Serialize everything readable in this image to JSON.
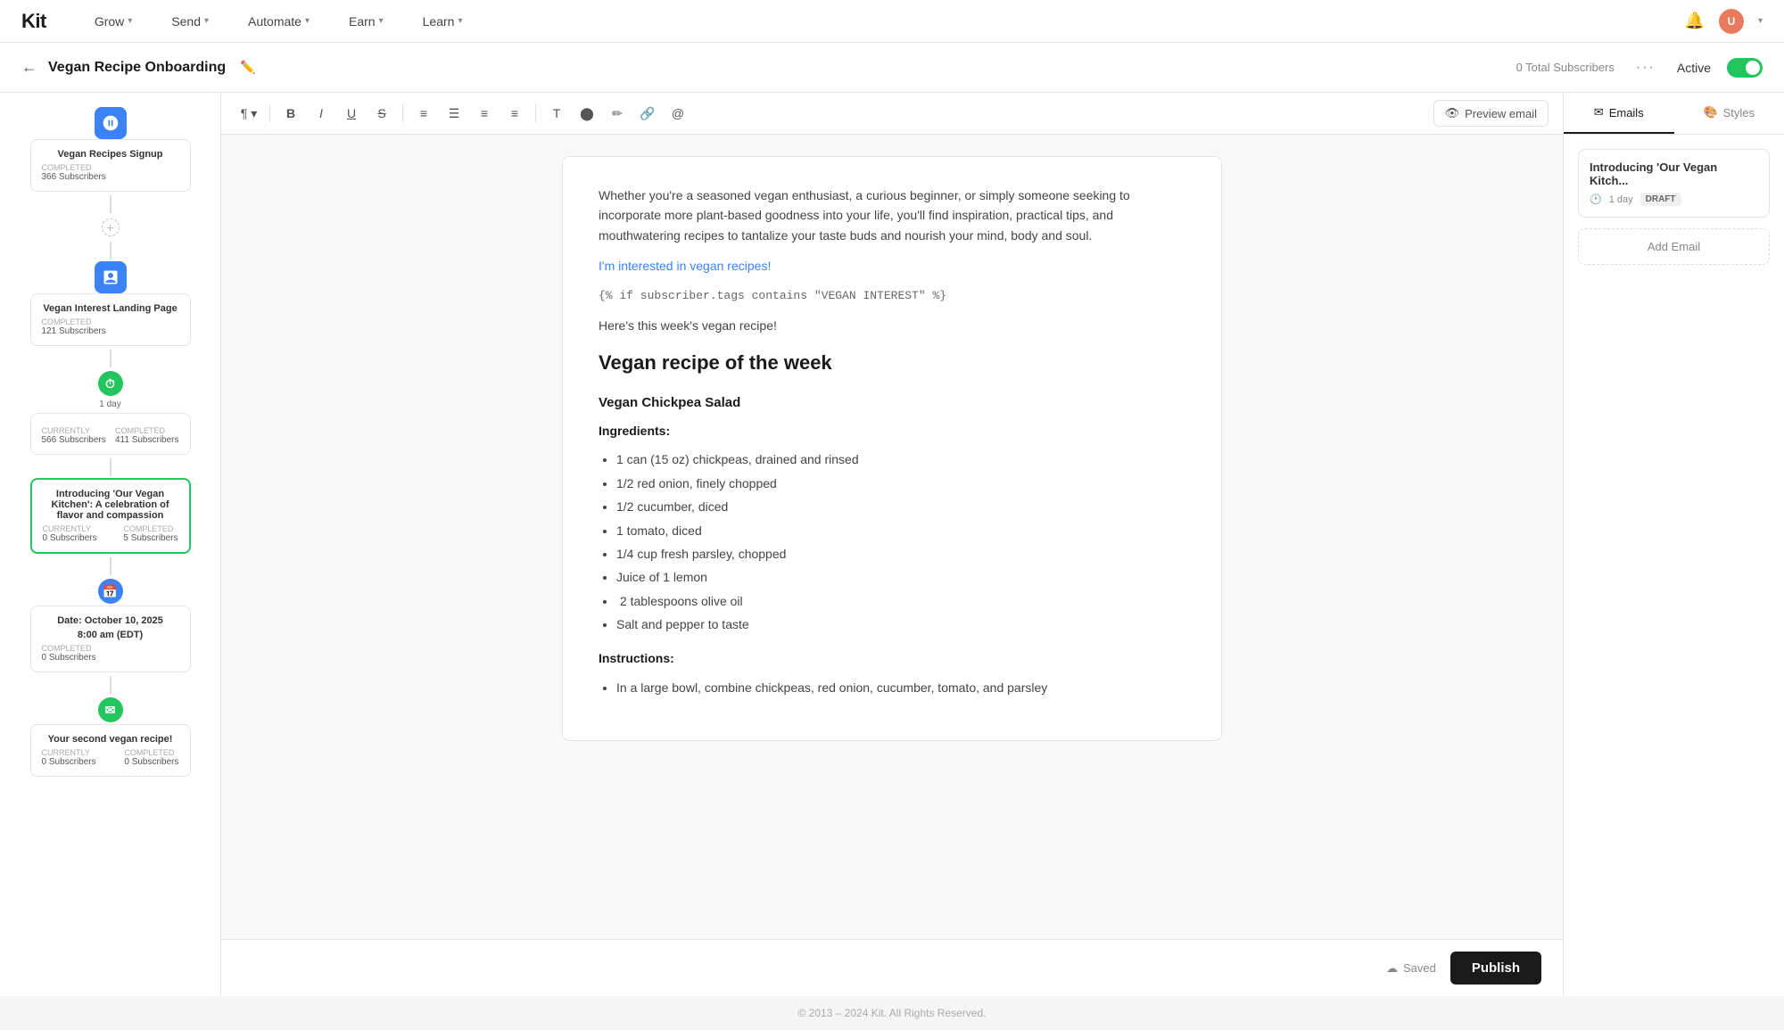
{
  "logo": "Kit",
  "nav": {
    "items": [
      {
        "label": "Grow",
        "has_chevron": true
      },
      {
        "label": "Send",
        "has_chevron": true
      },
      {
        "label": "Automate",
        "has_chevron": true
      },
      {
        "label": "Earn",
        "has_chevron": true
      },
      {
        "label": "Learn",
        "has_chevron": true
      }
    ]
  },
  "sub_header": {
    "title": "Vegan Recipe Onboarding",
    "total_subscribers": "0 Total Subscribers",
    "active_label": "Active"
  },
  "toolbar": {
    "preview_label": "Preview email"
  },
  "email": {
    "intro_text": "Whether you're a seasoned vegan enthusiast, a curious beginner, or simply someone seeking to incorporate more plant-based goodness into your life, you'll find inspiration, practical tips, and mouthwatering recipes to tantalize your taste buds and nourish your mind, body and soul.",
    "link_text": "I'm interested in vegan recipes!",
    "conditional_tag": "{% if subscriber.tags contains \"VEGAN INTEREST\" %}",
    "body_text": "Here's this week's vegan recipe!",
    "recipe_heading": "Vegan recipe of the week",
    "recipe_title": "Vegan Chickpea Salad",
    "ingredients_label": "Ingredients:",
    "ingredients": [
      "1 can (15 oz) chickpeas, drained and rinsed",
      "1/2 red onion, finely chopped",
      "1/2 cucumber, diced",
      "1 tomato, diced",
      "1/4 cup fresh parsley, chopped",
      "Juice of 1 lemon",
      "2 tablespoons olive oil",
      "Salt and pepper to taste"
    ],
    "instructions_label": "Instructions:",
    "instructions_partial": "In a large bowl, combine chickpeas, red onion, cucumber, tomato, and parsley"
  },
  "flow_nodes": [
    {
      "type": "blue_card",
      "title": "Vegan Recipes Signup",
      "status": "COMPLETED",
      "stat_label_left": "",
      "stat_value_left": "366 Subscribers",
      "stat_label_right": "",
      "stat_value_right": ""
    },
    {
      "type": "blue_card",
      "title": "Vegan Interest Landing Page",
      "status": "COMPLETED",
      "stat_value_left": "121 Subscribers",
      "stat_value_right": ""
    },
    {
      "type": "wait",
      "label": "1 day",
      "stat_label_left": "CURRENTLY",
      "stat_value_left": "566 Subscribers",
      "stat_label_right": "COMPLETED",
      "stat_value_right": "411 Subscribers"
    },
    {
      "type": "email_selected",
      "title": "Introducing 'Our Vegan Kitchen': A celebration of flavor and compassion",
      "stat_label_left": "CURRENTLY",
      "stat_value_left": "0 Subscribers",
      "stat_label_right": "COMPLETED",
      "stat_value_right": "5 Subscribers"
    },
    {
      "type": "scheduled",
      "title": "Date: October 10, 2025",
      "subtitle": "8:00 am (EDT)",
      "status": "COMPLETED",
      "stat_value_left": "0 Subscribers"
    },
    {
      "type": "email_green",
      "title": "Your second vegan recipe!",
      "stat_label_left": "CURRENTLY",
      "stat_value_left": "0 Subscribers",
      "stat_label_right": "COMPLETED",
      "stat_value_right": "0 Subscribers"
    }
  ],
  "right_sidebar": {
    "tabs": [
      {
        "label": "Emails",
        "active": true
      },
      {
        "label": "Styles",
        "active": false
      }
    ],
    "email_entry": {
      "title": "Introducing 'Our Vegan Kitch...",
      "delay": "1 day",
      "badge": "DRAFT"
    },
    "add_email_label": "Add Email"
  },
  "footer_bar": {
    "saved_label": "Saved",
    "publish_label": "Publish"
  },
  "page_footer": "© 2013 – 2024 Kit. All Rights Reserved."
}
